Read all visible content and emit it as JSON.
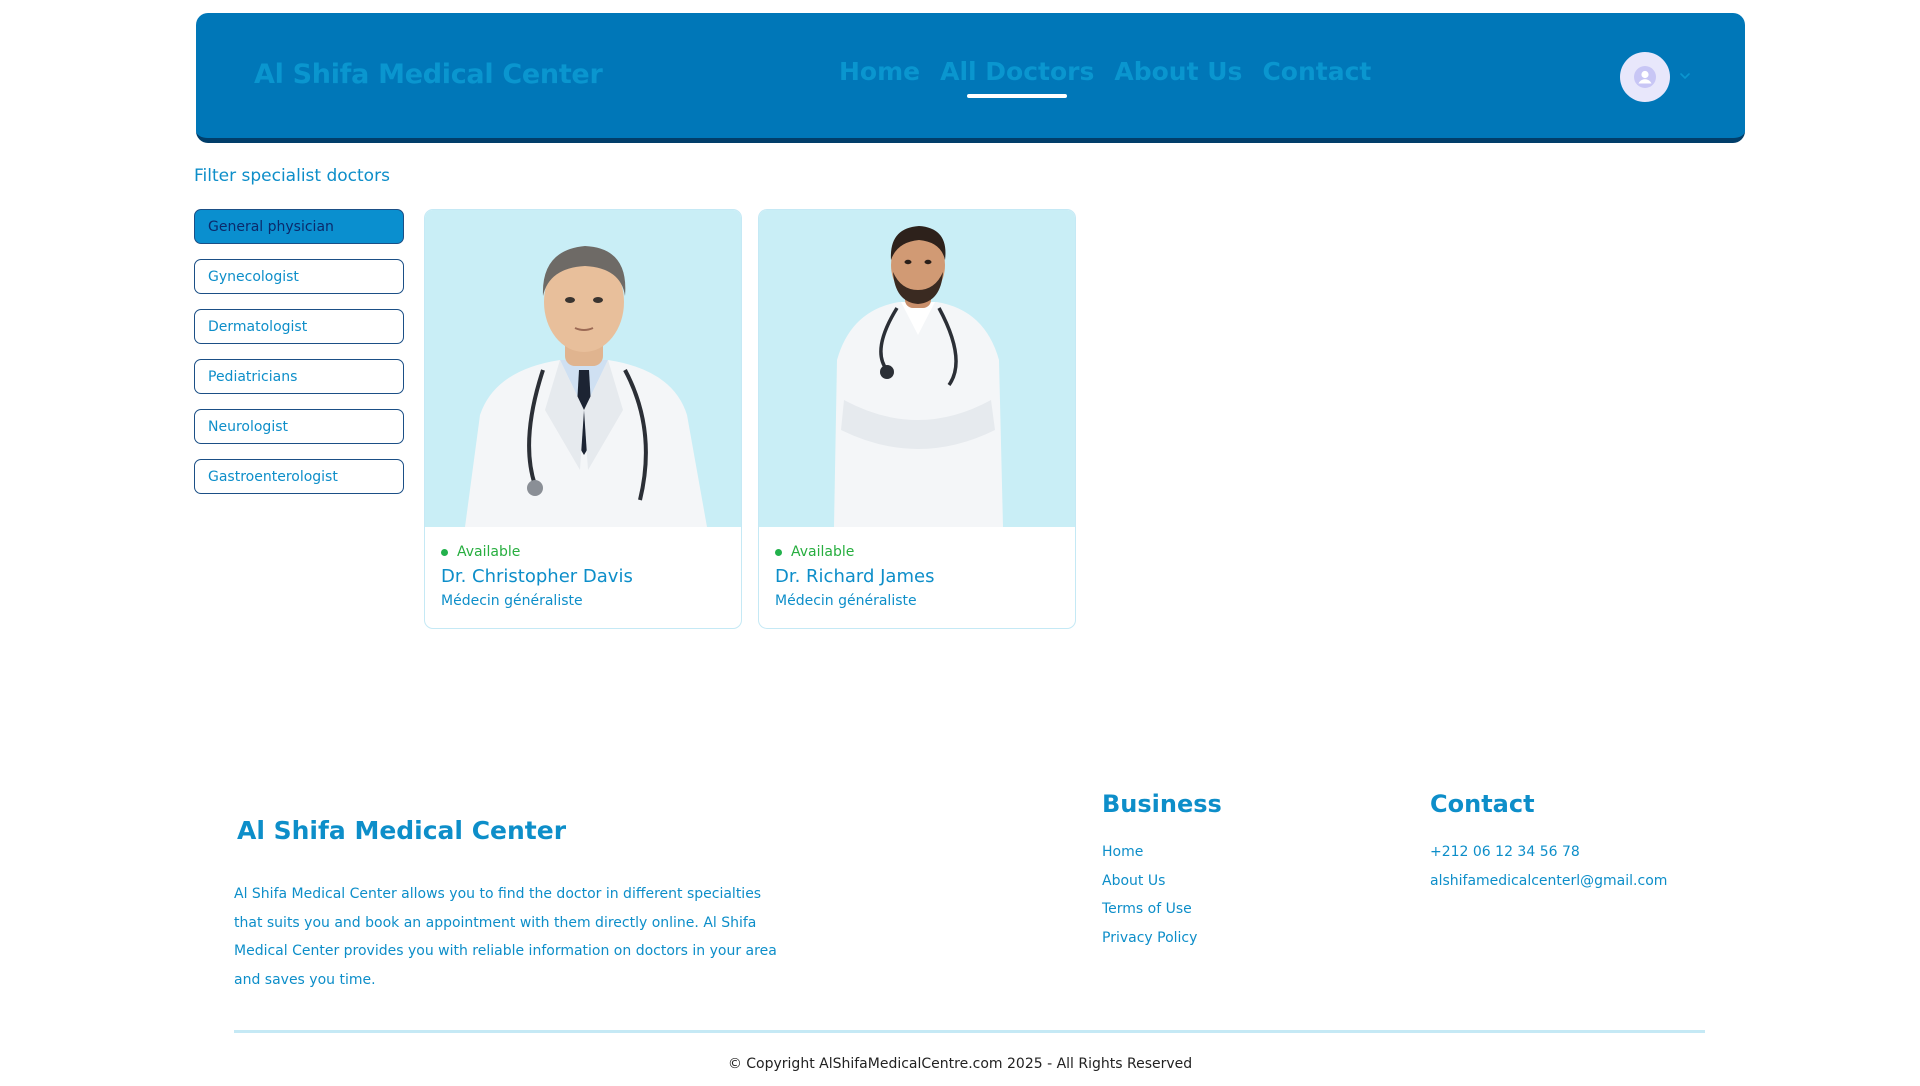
{
  "header": {
    "brand": "Al Shifa Medical Center",
    "nav": [
      "Home",
      "All Doctors",
      "About Us",
      "Contact"
    ],
    "active_nav": "All Doctors"
  },
  "filter": {
    "title": "Filter specialist doctors",
    "options": [
      "General physician",
      "Gynecologist",
      "Dermatologist",
      "Pediatricians",
      "Neurologist",
      "Gastroenterologist"
    ],
    "selected": "General physician"
  },
  "doctors": [
    {
      "status": "Available",
      "name": "Dr. Christopher Davis",
      "specialty": "Médecin généraliste"
    },
    {
      "status": "Available",
      "name": "Dr. Richard James",
      "specialty": "Médecin généraliste"
    }
  ],
  "footer": {
    "brand": "Al Shifa Medical Center",
    "description": "Al Shifa Medical Center allows you to find the doctor in different specialties that suits you and book an appointment with them directly online. Al Shifa Medical Center provides you with reliable information on doctors in your area and saves you time.",
    "business": {
      "title": "Business",
      "links": [
        "Home",
        "About Us",
        "Terms of Use",
        "Privacy Policy"
      ]
    },
    "contact": {
      "title": "Contact",
      "items": [
        "+212 06 12 34 56 78",
        "alshifamedicalcenterl@gmail.com"
      ]
    },
    "copyright": "© Copyright AlShifaMedicalCentre.com 2025 - All Rights Reserved"
  },
  "colors": {
    "header_bg": "#0077b8",
    "accent": "#0d8ec9",
    "available": "#22b14c",
    "card_image_bg": "#c9eef6"
  }
}
